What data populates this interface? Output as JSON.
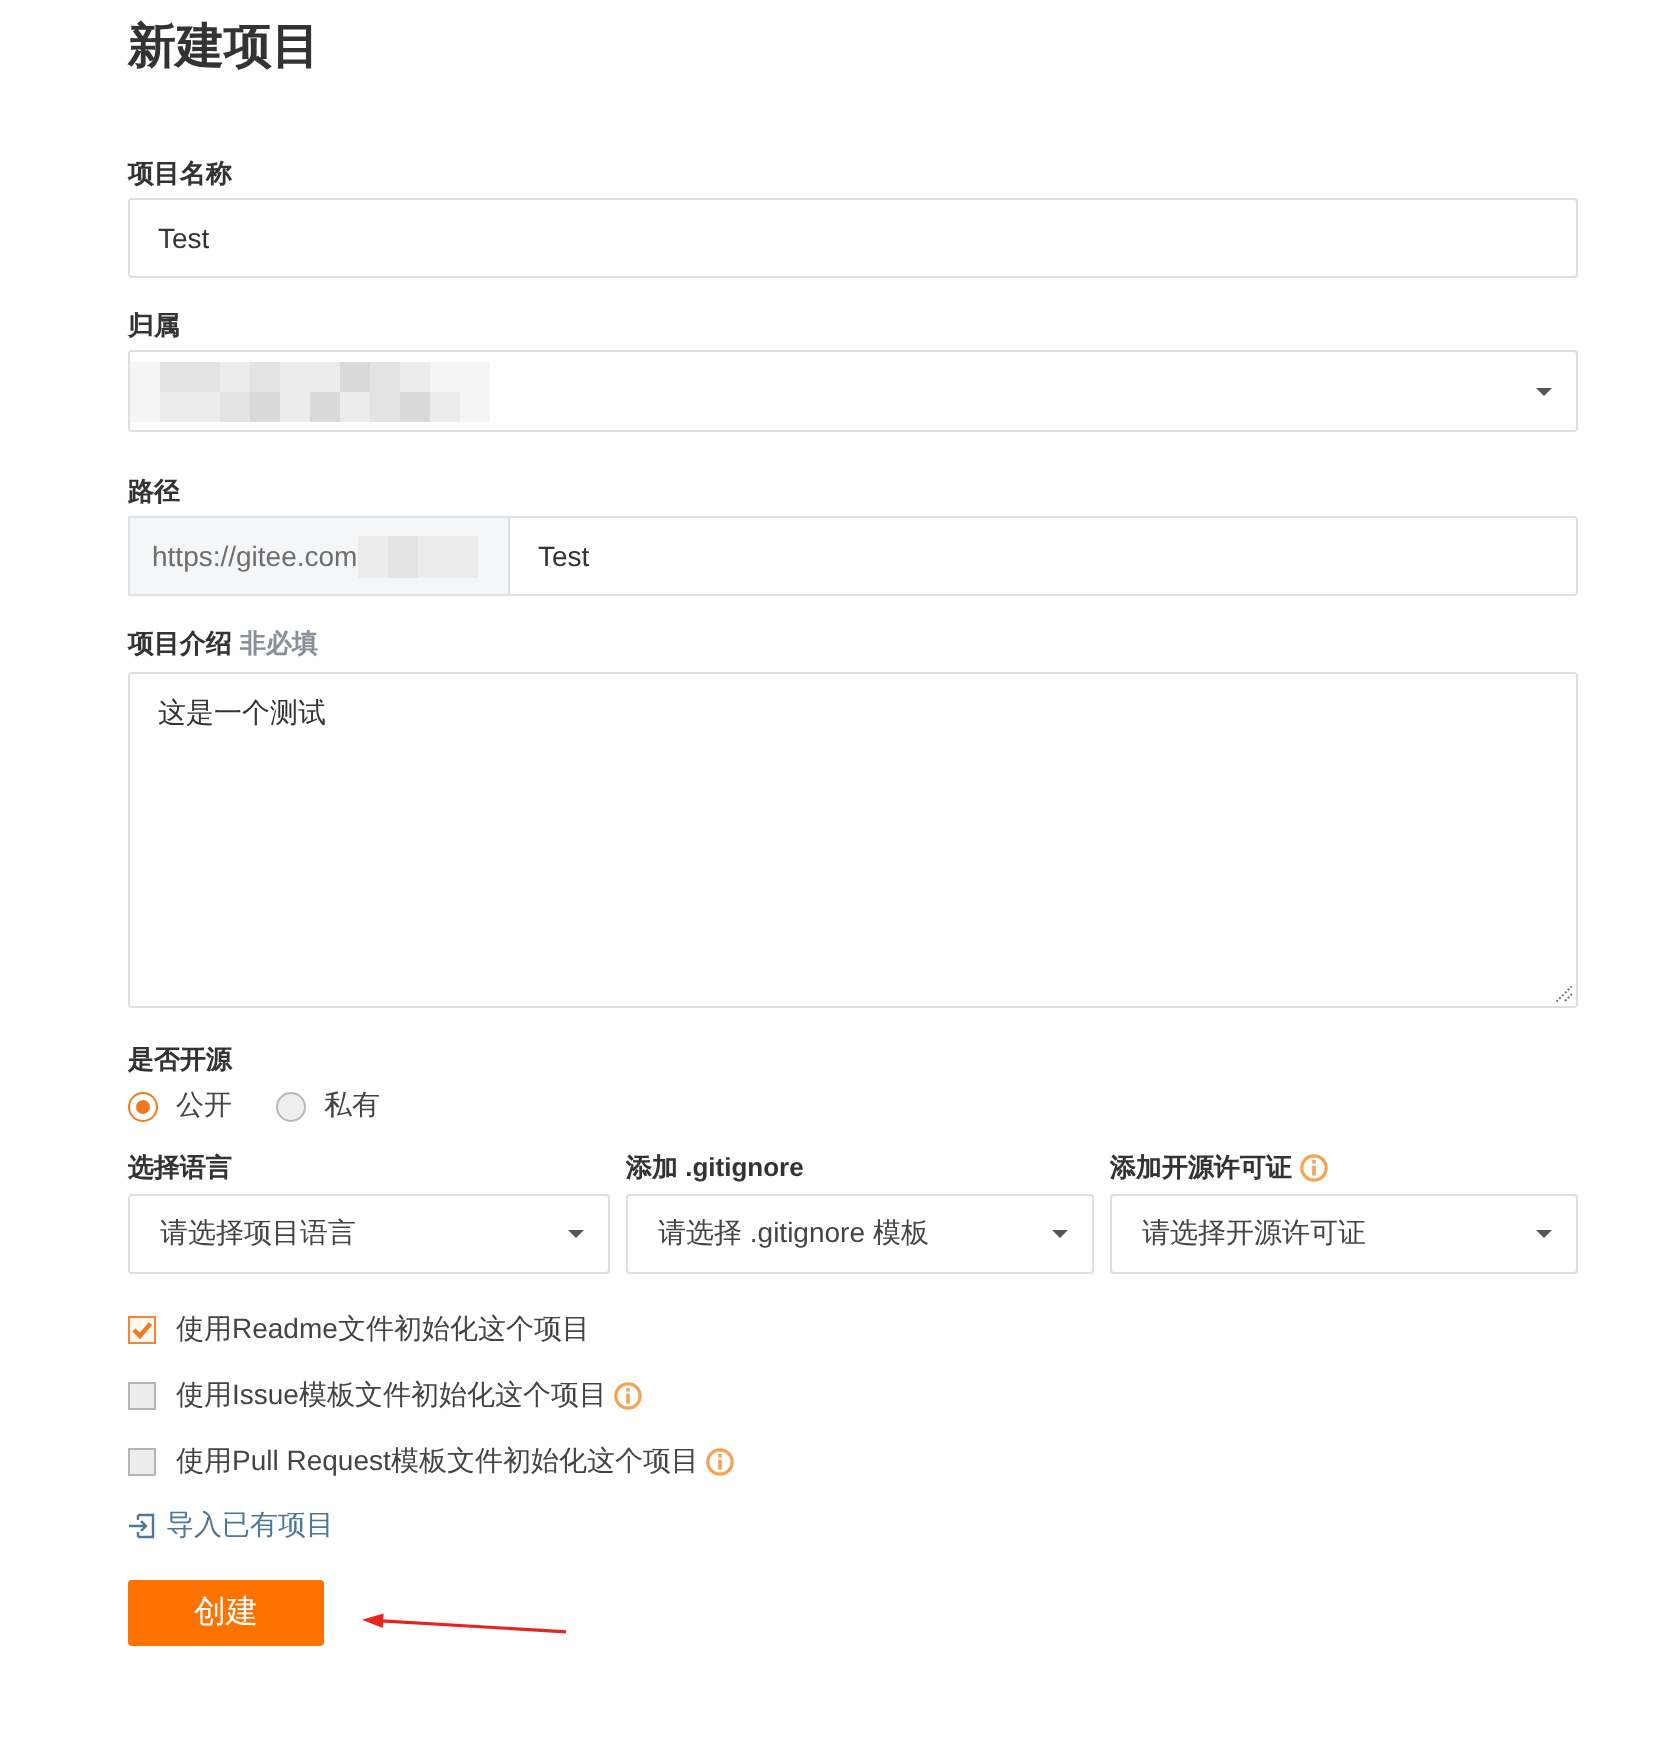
{
  "page": {
    "title": "新建项目"
  },
  "name_field": {
    "label": "项目名称",
    "value": "Test"
  },
  "owner_field": {
    "label": "归属",
    "value_redacted": true
  },
  "path_field": {
    "label": "路径",
    "prefix": "https://gitee.com",
    "prefix_redacted": true,
    "value": "Test"
  },
  "description_field": {
    "label": "项目介绍",
    "hint": "非必填",
    "value": "这是一个测试"
  },
  "visibility": {
    "label": "是否开源",
    "options": [
      {
        "label": "公开",
        "selected": true
      },
      {
        "label": "私有",
        "selected": false
      }
    ]
  },
  "selects": [
    {
      "label": "选择语言",
      "info": false,
      "placeholder": "请选择项目语言"
    },
    {
      "label": "添加 .gitignore",
      "info": false,
      "placeholder": "请选择 .gitignore 模板"
    },
    {
      "label": "添加开源许可证",
      "info": true,
      "placeholder": "请选择开源许可证"
    }
  ],
  "init_options": [
    {
      "label": "使用Readme文件初始化这个项目",
      "checked": true,
      "info": false
    },
    {
      "label": "使用Issue模板文件初始化这个项目",
      "checked": false,
      "info": true
    },
    {
      "label": "使用Pull Request模板文件初始化这个项目",
      "checked": false,
      "info": true
    }
  ],
  "import_link": {
    "label": "导入已有项目"
  },
  "submit_button": {
    "label": "创建"
  }
}
